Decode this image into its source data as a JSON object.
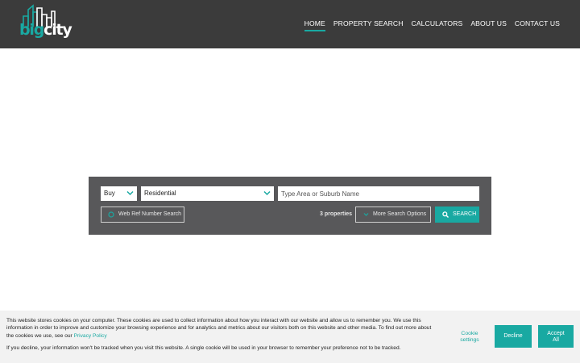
{
  "brand": {
    "logo_big": "big",
    "logo_city": "city",
    "accent_color": "#19a9a2",
    "header_color": "#3b3b3b"
  },
  "nav": {
    "items": [
      {
        "label": "HOME",
        "active": true
      },
      {
        "label": "PROPERTY SEARCH",
        "active": false
      },
      {
        "label": "CALCULATORS",
        "active": false
      },
      {
        "label": "ABOUT US",
        "active": false
      },
      {
        "label": "CONTACT US",
        "active": false
      }
    ]
  },
  "search": {
    "listing_type": "Buy",
    "property_type": "Residential",
    "area_placeholder": "Type Area or Suburb Name",
    "ref_search_label": "Web Ref Number Search",
    "property_count": "3 properties",
    "more_options_label": "More Search Options",
    "search_label": "SEARCH",
    "panel_color": "#58585a"
  },
  "cookie": {
    "text_main": "This website stores cookies on your computer. These cookies are used to collect information about how you interact with our website and allow us to remember you. We use this information in order to improve and customize your browsing experience and for analytics and metrics about our visitors both on this website and other media. To find out more about the cookies we use, see our ",
    "privacy_link": "Privacy Policy",
    "text_decline_info": "If you decline, your information won't be tracked when you visit this website. A single cookie will be used in your browser to remember your preference not to be tracked.",
    "settings_line1": "Cookie",
    "settings_line2": "settings",
    "decline_label": "Decline",
    "accept_line1": "Accept",
    "accept_line2": "All"
  },
  "icons": [
    "logo-buildings-icon",
    "chevron-down-icon",
    "search-icon",
    "circle-icon"
  ]
}
